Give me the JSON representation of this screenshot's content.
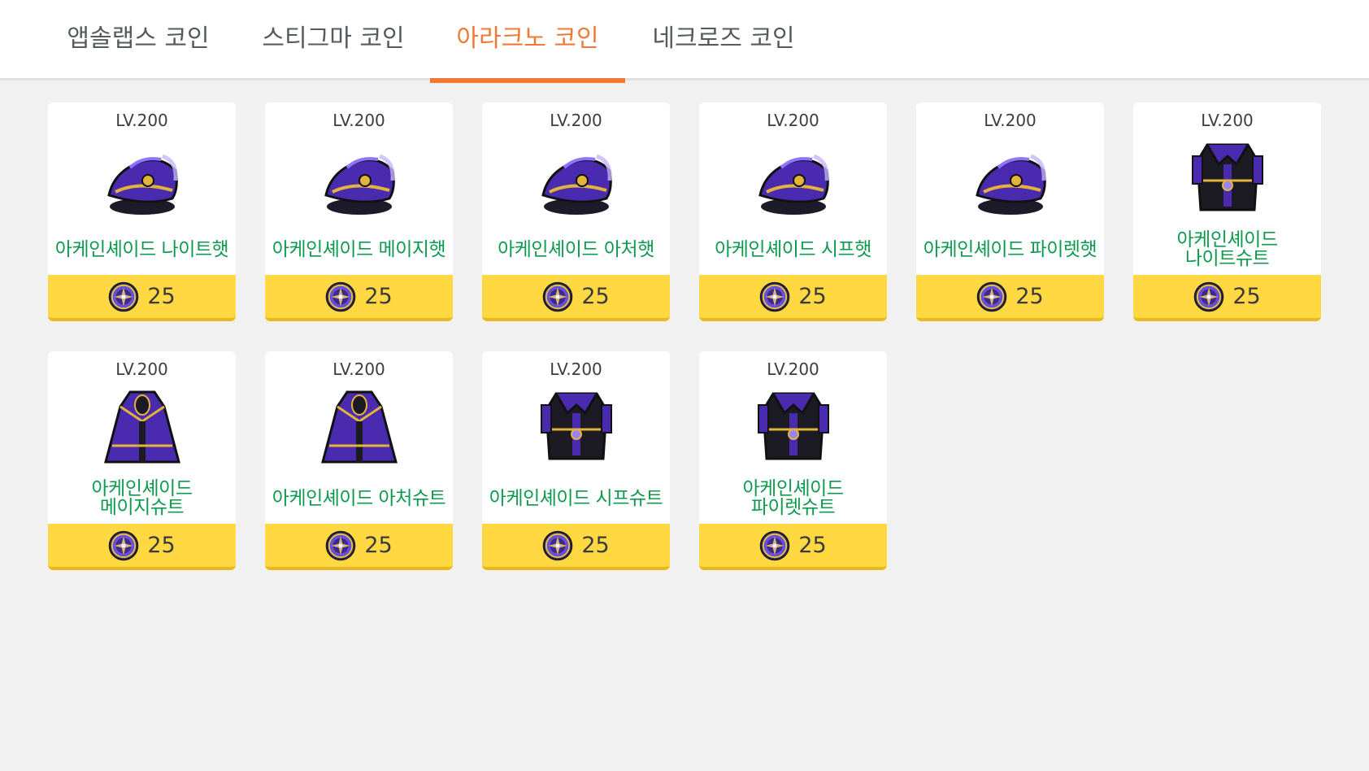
{
  "tabs": [
    {
      "label": "앱솔랩스 코인",
      "active": false
    },
    {
      "label": "스티그마 코인",
      "active": false
    },
    {
      "label": "아라크노 코인",
      "active": true
    },
    {
      "label": "네크로즈 코인",
      "active": false
    }
  ],
  "items": [
    {
      "level": "LV.200",
      "name": "아케인셰이드 나이트햇",
      "price": "25",
      "icon": "hat-icon"
    },
    {
      "level": "LV.200",
      "name": "아케인셰이드 메이지햇",
      "price": "25",
      "icon": "hat-icon"
    },
    {
      "level": "LV.200",
      "name": "아케인셰이드 아처햇",
      "price": "25",
      "icon": "hat-icon"
    },
    {
      "level": "LV.200",
      "name": "아케인셰이드 시프햇",
      "price": "25",
      "icon": "hat-icon"
    },
    {
      "level": "LV.200",
      "name": "아케인셰이드 파이렛햇",
      "price": "25",
      "icon": "hat-icon"
    },
    {
      "level": "LV.200",
      "name": "아케인셰이드\n나이트슈트",
      "price": "25",
      "icon": "suit-icon"
    },
    {
      "level": "LV.200",
      "name": "아케인셰이드\n메이지슈트",
      "price": "25",
      "icon": "robe-icon"
    },
    {
      "level": "LV.200",
      "name": "아케인셰이드 아처슈트",
      "price": "25",
      "icon": "robe-icon"
    },
    {
      "level": "LV.200",
      "name": "아케인셰이드 시프슈트",
      "price": "25",
      "icon": "suit-icon"
    },
    {
      "level": "LV.200",
      "name": "아케인셰이드\n파이렛슈트",
      "price": "25",
      "icon": "suit-icon"
    }
  ],
  "currency_icon": "arcane-coin-icon",
  "colors": {
    "accent": "#ef7a36",
    "item_name": "#0e9a4e",
    "price_bg": "#ffd842",
    "item_purple": "#4a2bb0",
    "item_gold": "#e3b43a"
  }
}
